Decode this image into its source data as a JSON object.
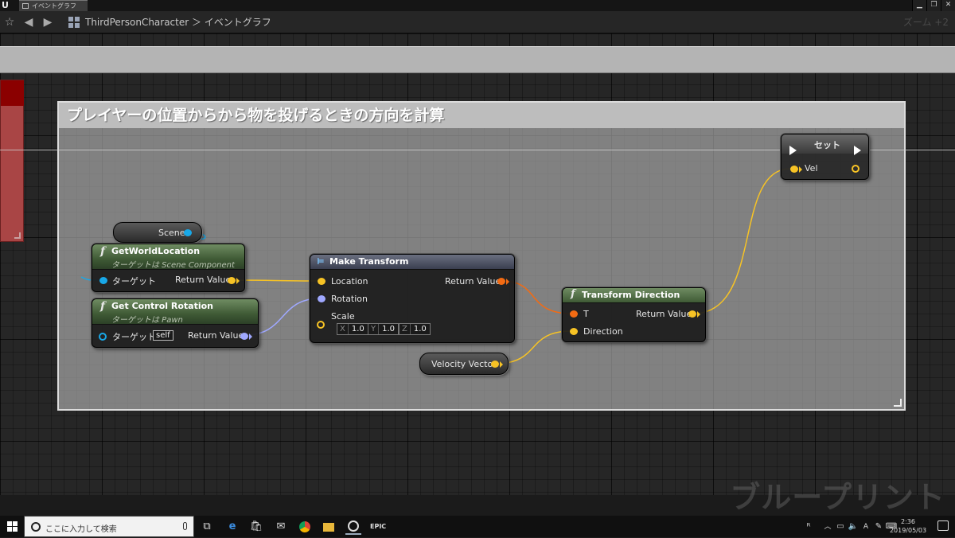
{
  "window": {
    "tab_label": "イベントグラフ",
    "breadcrumb": "ThirdPersonCharacter ＞ イベントグラフ",
    "zoom": "ズーム +2",
    "logo": "U"
  },
  "comment": {
    "title": "プレイヤーの位置からから物を投げるときの方向を計算"
  },
  "nodes": {
    "scene": {
      "label": "Scene"
    },
    "get_world_location": {
      "title": "GetWorldLocation",
      "subtitle": "ターゲットは Scene Component",
      "in_target": "ターゲット",
      "out_return": "Return Value"
    },
    "get_control_rotation": {
      "title": "Get Control Rotation",
      "subtitle": "ターゲットは Pawn",
      "in_target": "ターゲット",
      "self_value": "self",
      "out_return": "Return Value"
    },
    "make_transform": {
      "title": "Make Transform",
      "in_location": "Location",
      "in_rotation": "Rotation",
      "in_scale": "Scale",
      "scale_x_label": "X",
      "scale_x": "1.0",
      "scale_y_label": "Y",
      "scale_y": "1.0",
      "scale_z_label": "Z",
      "scale_z": "1.0",
      "out_return": "Return Value"
    },
    "velocity_vector": {
      "label": "Velocity Vector"
    },
    "transform_direction": {
      "title": "Transform Direction",
      "in_t": "T",
      "in_direction": "Direction",
      "out_return": "Return Value"
    },
    "set_node": {
      "title": "セット",
      "in_vel": "Vel"
    }
  },
  "watermark": "ブループリント",
  "taskbar": {
    "search_placeholder": "ここに入力して検索",
    "time": "2:36",
    "date": "2019/05/03",
    "icons": [
      "task-view-icon",
      "edge-icon",
      "store-icon",
      "mail-icon",
      "chrome-icon",
      "explorer-icon",
      "unreal-icon",
      "epic-icon"
    ]
  },
  "colors": {
    "vector_pin": "#f7c325",
    "rotator_pin": "#9fa8ff",
    "transform_pin": "#f36b13",
    "object_pin": "#18a8e8",
    "function_header": "#4d6b42",
    "comment_bg": "#b9b9b9"
  }
}
